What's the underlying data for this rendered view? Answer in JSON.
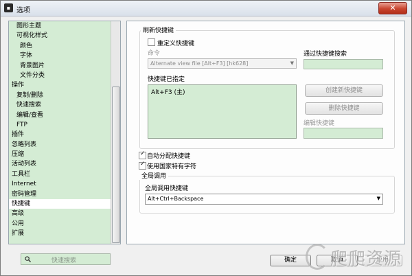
{
  "window": {
    "title": "选项",
    "close_glyph": "✕",
    "app_icon_glyph": "▪"
  },
  "sidebar": {
    "items": [
      {
        "label": "图形主题",
        "level": 1
      },
      {
        "label": "可视化样式",
        "level": 1
      },
      {
        "label": "颜色",
        "level": 2
      },
      {
        "label": "字体",
        "level": 2
      },
      {
        "label": "背景图片",
        "level": 2
      },
      {
        "label": "文件分类",
        "level": 2
      },
      {
        "label": "操作",
        "level": 0
      },
      {
        "label": "复制/删除",
        "level": 1
      },
      {
        "label": "快速搜索",
        "level": 1
      },
      {
        "label": "编辑/查看",
        "level": 1
      },
      {
        "label": "FTP",
        "level": 1
      },
      {
        "label": "插件",
        "level": 0
      },
      {
        "label": "忽略列表",
        "level": 0
      },
      {
        "label": "压缩",
        "level": 0
      },
      {
        "label": "活动列表",
        "level": 0
      },
      {
        "label": "工具栏",
        "level": 0
      },
      {
        "label": "Internet",
        "level": 0
      },
      {
        "label": "密码管理",
        "level": 0
      },
      {
        "label": "快捷键",
        "level": 0,
        "selected": true
      },
      {
        "label": "高级",
        "level": 0
      },
      {
        "label": "公用",
        "level": 0
      },
      {
        "label": "扩展",
        "level": 0
      }
    ]
  },
  "hotkeys": {
    "section_refresh": "刷新快捷键",
    "redefine_label": "重定义快捷键",
    "redefine_checked": false,
    "command_label": "命令",
    "command_value": "Alternate view file [Alt+F3] [hk628]",
    "search_by_hotkey_label": "通过快捷键搜索",
    "search_by_hotkey_value": "",
    "assigned_label": "快捷键已指定",
    "assigned_items": [
      "Alt+F3 (主)"
    ],
    "create_button": "创建新快捷键",
    "delete_button": "删除快捷键",
    "edit_label": "编辑快捷键",
    "edit_value": "",
    "auto_assign_label": "自动分配快捷键",
    "auto_assign_checked": true,
    "use_national_chars_label": "使用国家特有字符",
    "use_national_chars_checked": true,
    "global_section": "全局调用",
    "global_hotkey_label": "全局调用快捷键",
    "global_hotkey_value": "Alt+Ctrl+Backspace"
  },
  "footer": {
    "quick_search_placeholder": "快速搜索",
    "ok_button": "确定",
    "cancel_button": "取消",
    "apply_button": "应用"
  },
  "watermark": {
    "text": "爬爬资源"
  },
  "colors": {
    "panel_green": "#d4ecd4",
    "selected_row": "#ffffff",
    "close_red": "#c9452f"
  }
}
